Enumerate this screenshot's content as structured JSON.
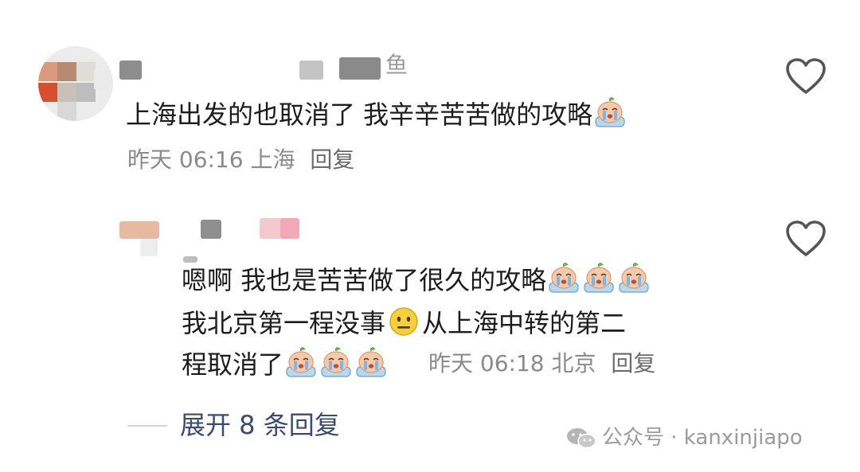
{
  "comments": [
    {
      "username_visible": "鱼",
      "line1": "上海出发的也取消了 我辛辛苦苦做的攻略",
      "meta": {
        "time": "昨天 06:16",
        "location": "上海",
        "reply": "回复"
      },
      "emoji": "crying-face-icon"
    }
  ],
  "reply": {
    "line1": "嗯啊 我也是苦苦做了很久的攻略",
    "line2a": "我北京第一程没事",
    "line2b": "从上海中转的第二",
    "line3": "程取消了",
    "meta": {
      "time": "昨天 06:18",
      "location": "北京",
      "reply": "回复"
    }
  },
  "expand_label": "展开 8 条回复",
  "watermark": "公众号 · kanxinjiapo",
  "colors": {
    "text": "#1c1c1c",
    "meta": "#8a8a8a",
    "link": "#3a4a70",
    "heart": "#555555"
  }
}
